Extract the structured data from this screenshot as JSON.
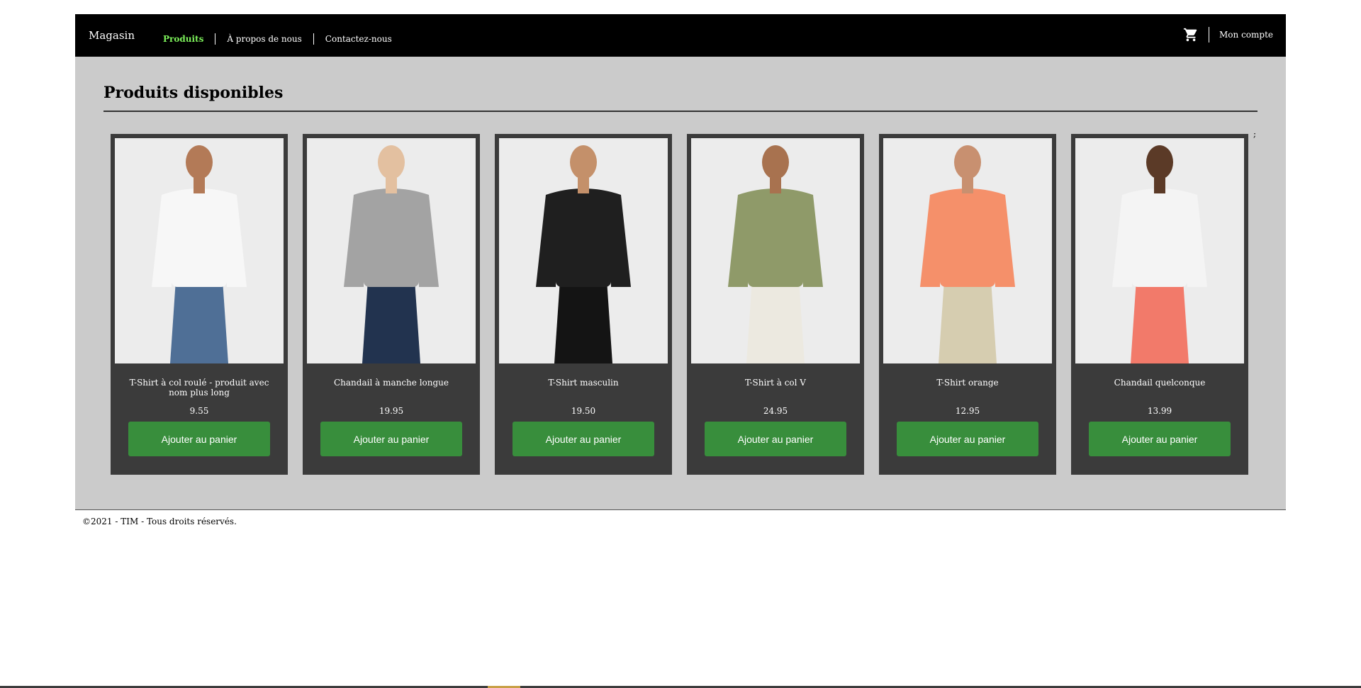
{
  "navbar": {
    "brand": "Magasin",
    "links": [
      {
        "label": "Produits",
        "active": true
      },
      {
        "label": "À propos de nous",
        "active": false
      },
      {
        "label": "Contactez-nous",
        "active": false
      }
    ],
    "cart_icon": "shopping-cart-icon",
    "account_label": "Mon compte"
  },
  "main": {
    "title": "Produits disponibles",
    "stray_text": ";"
  },
  "products": [
    {
      "name": "T-Shirt à col roulé - produit avec nom plus long",
      "price": "9.55",
      "button_label": "Ajouter au panier",
      "shirt_color": "#f7f7f7",
      "bottom_color": "#4f6f96",
      "skin": "#b37a57"
    },
    {
      "name": "Chandail à manche longue",
      "price": "19.95",
      "button_label": "Ajouter au panier",
      "shirt_color": "#a3a3a3",
      "bottom_color": "#22334f",
      "skin": "#e3c0a0"
    },
    {
      "name": "T-Shirt masculin",
      "price": "19.50",
      "button_label": "Ajouter au panier",
      "shirt_color": "#1f1f1f",
      "bottom_color": "#141414",
      "skin": "#c4906a"
    },
    {
      "name": "T-Shirt à col V",
      "price": "24.95",
      "button_label": "Ajouter au panier",
      "shirt_color": "#8f9a69",
      "bottom_color": "#ece9e0",
      "skin": "#a8724f"
    },
    {
      "name": "T-Shirt orange",
      "price": "12.95",
      "button_label": "Ajouter au panier",
      "shirt_color": "#f5906a",
      "bottom_color": "#d6cdb0",
      "skin": "#c89070"
    },
    {
      "name": "Chandail quelconque",
      "price": "13.99",
      "button_label": "Ajouter au panier",
      "shirt_color": "#f4f4f4",
      "bottom_color": "#f27a6a",
      "skin": "#5b3a27"
    }
  ],
  "footer": {
    "text": "©2021 - TIM - Tous droits réservés."
  },
  "colors": {
    "navbar_bg": "#000000",
    "active_link": "#7cf05a",
    "content_bg": "#cbcbcb",
    "card_bg": "#3b3b3b",
    "button_bg": "#388e3c"
  }
}
